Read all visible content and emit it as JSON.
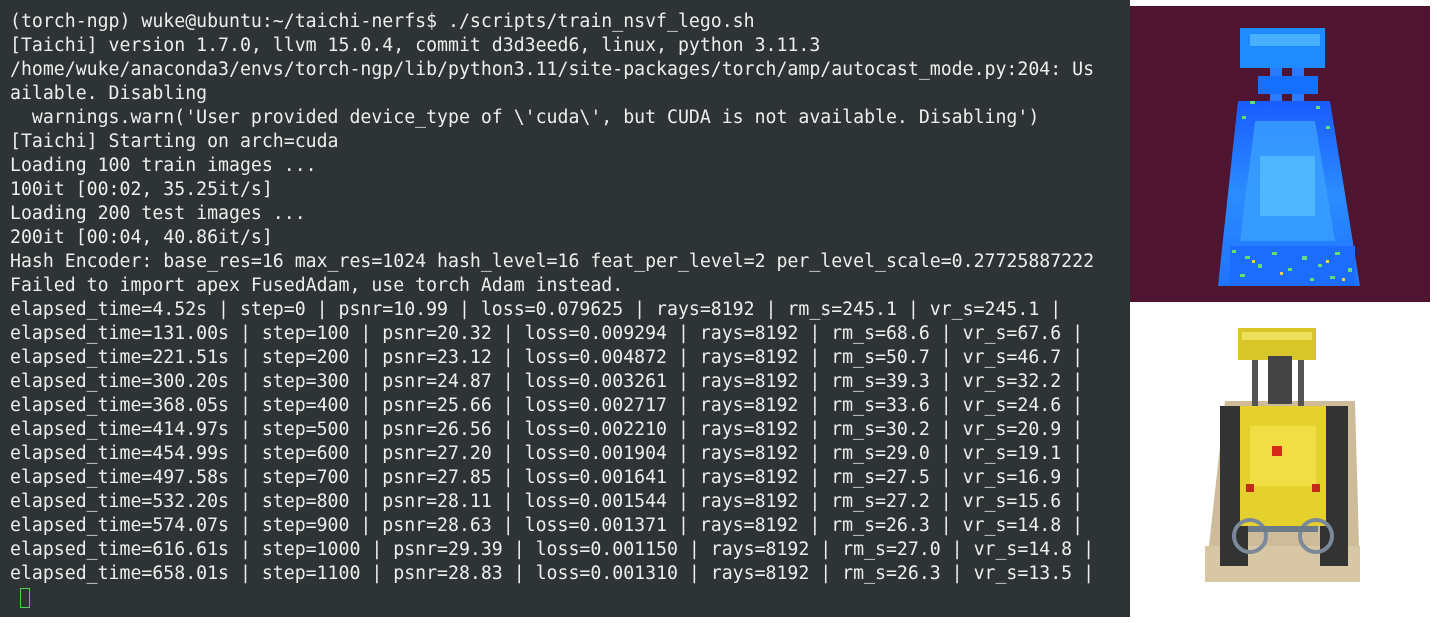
{
  "terminal": {
    "lines": [
      "(torch-ngp) wuke@ubuntu:~/taichi-nerfs$ ./scripts/train_nsvf_lego.sh",
      "[Taichi] version 1.7.0, llvm 15.0.4, commit d3d3eed6, linux, python 3.11.3",
      "/home/wuke/anaconda3/envs/torch-ngp/lib/python3.11/site-packages/torch/amp/autocast_mode.py:204: Us",
      "ailable. Disabling",
      "  warnings.warn('User provided device_type of \\'cuda\\', but CUDA is not available. Disabling')",
      "[Taichi] Starting on arch=cuda",
      "Loading 100 train images ...",
      "100it [00:02, 35.25it/s]",
      "Loading 200 test images ...",
      "200it [00:04, 40.86it/s]",
      "Hash Encoder: base_res=16 max_res=1024 hash_level=16 feat_per_level=2 per_level_scale=0.27725887222",
      "Failed to import apex FusedAdam, use torch Adam instead.",
      "elapsed_time=4.52s | step=0 | psnr=10.99 | loss=0.079625 | rays=8192 | rm_s=245.1 | vr_s=245.1 |",
      "elapsed_time=131.00s | step=100 | psnr=20.32 | loss=0.009294 | rays=8192 | rm_s=68.6 | vr_s=67.6 |",
      "elapsed_time=221.51s | step=200 | psnr=23.12 | loss=0.004872 | rays=8192 | rm_s=50.7 | vr_s=46.7 |",
      "elapsed_time=300.20s | step=300 | psnr=24.87 | loss=0.003261 | rays=8192 | rm_s=39.3 | vr_s=32.2 |",
      "elapsed_time=368.05s | step=400 | psnr=25.66 | loss=0.002717 | rays=8192 | rm_s=33.6 | vr_s=24.6 |",
      "elapsed_time=414.97s | step=500 | psnr=26.56 | loss=0.002210 | rays=8192 | rm_s=30.2 | vr_s=20.9 |",
      "elapsed_time=454.99s | step=600 | psnr=27.20 | loss=0.001904 | rays=8192 | rm_s=29.0 | vr_s=19.1 |",
      "elapsed_time=497.58s | step=700 | psnr=27.85 | loss=0.001641 | rays=8192 | rm_s=27.5 | vr_s=16.9 |",
      "elapsed_time=532.20s | step=800 | psnr=28.11 | loss=0.001544 | rays=8192 | rm_s=27.2 | vr_s=15.6 |",
      "elapsed_time=574.07s | step=900 | psnr=28.63 | loss=0.001371 | rays=8192 | rm_s=26.3 | vr_s=14.8 |",
      "elapsed_time=616.61s | step=1000 | psnr=29.39 | loss=0.001150 | rays=8192 | rm_s=27.0 | vr_s=14.8 |",
      "elapsed_time=658.01s | step=1100 | psnr=28.83 | loss=0.001310 | rays=8192 | rm_s=26.3 | vr_s=13.5 |"
    ]
  },
  "colors": {
    "terminal_bg": "#2e3436",
    "terminal_fg": "#eeeeec",
    "cursor": "#4fd34f",
    "depth_bg": "#4e1430"
  },
  "images": {
    "depth_icon": "lego-depth-render-icon",
    "rgb_icon": "lego-bulldozer-render-icon"
  }
}
